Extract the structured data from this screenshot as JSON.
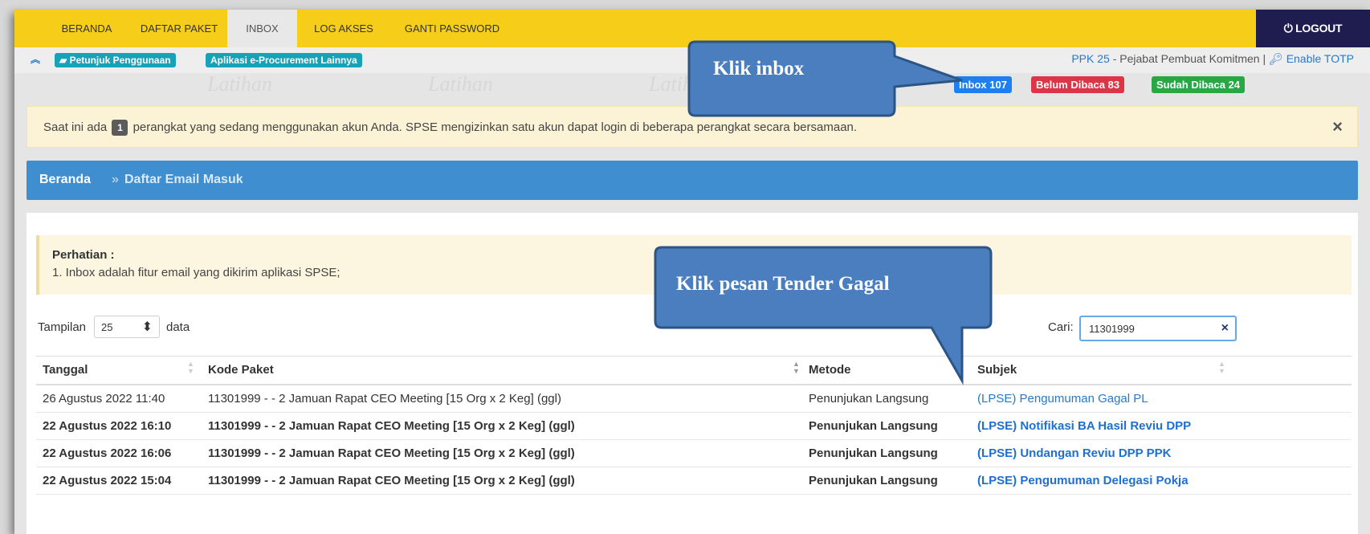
{
  "navbar": {
    "items": [
      "BERANDA",
      "DAFTAR PAKET",
      "INBOX",
      "LOG AKSES",
      "GANTI PASSWORD"
    ],
    "logout": "LOGOUT"
  },
  "subbar": {
    "guide": "Petunjuk Penggunaan",
    "apps": "Aplikasi e-Procurement Lainnya",
    "user_link": "PPK 25",
    "user_role": " - Pejabat Pembuat Komitmen | ",
    "totp": "Enable TOTP",
    "watermark": "Latihan"
  },
  "badges": {
    "inbox": "Inbox 107",
    "unread": "Belum Dibaca 83",
    "read": "Sudah Dibaca 24"
  },
  "alert": {
    "prefix": "Saat ini ada",
    "count": "1",
    "suffix": "perangkat yang sedang menggunakan akun Anda. SPSE mengizinkan satu akun dapat login di beberapa perangkat secara bersamaan."
  },
  "breadcrumb": {
    "home": "Beranda",
    "sep": "»",
    "current": "Daftar Email Masuk"
  },
  "note": {
    "title": "Perhatian :",
    "line": "1. Inbox adalah fitur email yang dikirim aplikasi SPSE;"
  },
  "table_controls": {
    "show_label": "Tampilan",
    "show_value": "25",
    "show_suffix": "data",
    "search_label": "Cari:",
    "search_value": "11301999"
  },
  "table": {
    "headers": [
      "Tanggal",
      "Kode Paket",
      "Metode",
      "Subjek"
    ],
    "rows": [
      {
        "date": "26 Agustus 2022 11:40",
        "code": "11301999 - - 2 Jamuan Rapat CEO Meeting [15 Org x 2 Keg] (ggl)",
        "method": "Penunjukan Langsung",
        "subject": "(LPSE) Pengumuman Gagal PL",
        "bold": false
      },
      {
        "date": "22 Agustus 2022 16:10",
        "code": "11301999 - - 2 Jamuan Rapat CEO Meeting [15 Org x 2 Keg] (ggl)",
        "method": "Penunjukan Langsung",
        "subject": "(LPSE) Notifikasi BA Hasil Reviu DPP",
        "bold": true
      },
      {
        "date": "22 Agustus 2022 16:06",
        "code": "11301999 - - 2 Jamuan Rapat CEO Meeting [15 Org x 2 Keg] (ggl)",
        "method": "Penunjukan Langsung",
        "subject": "(LPSE) Undangan Reviu DPP PPK",
        "bold": true
      },
      {
        "date": "22 Agustus 2022 15:04",
        "code": "11301999 - - 2 Jamuan Rapat CEO Meeting [15 Org x 2 Keg] (ggl)",
        "method": "Penunjukan Langsung",
        "subject": "(LPSE) Pengumuman Delegasi Pokja",
        "bold": true
      }
    ]
  },
  "callouts": {
    "inbox": "Klik inbox",
    "message": "Klik pesan Tender Gagal"
  },
  "colors": {
    "navbar": "#f6ce1a",
    "logout": "#1f1d4f",
    "breadcrumb": "#3e8ed0",
    "callout_fill": "#4a7ebf",
    "callout_border": "#2c5585",
    "badge_inbox": "#1e7ff0",
    "badge_unread": "#dc3545",
    "badge_read": "#28a745"
  }
}
